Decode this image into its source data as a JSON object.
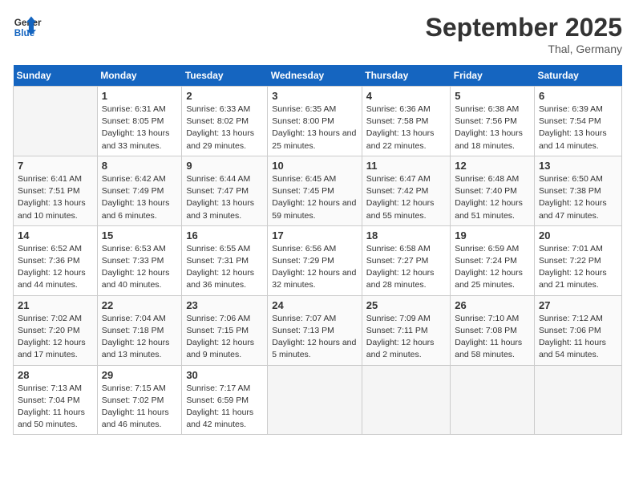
{
  "header": {
    "logo_line1": "General",
    "logo_line2": "Blue",
    "month_title": "September 2025",
    "location": "Thal, Germany"
  },
  "weekdays": [
    "Sunday",
    "Monday",
    "Tuesday",
    "Wednesday",
    "Thursday",
    "Friday",
    "Saturday"
  ],
  "weeks": [
    [
      {
        "day": "",
        "sunrise": "",
        "sunset": "",
        "daylight": ""
      },
      {
        "day": "1",
        "sunrise": "Sunrise: 6:31 AM",
        "sunset": "Sunset: 8:05 PM",
        "daylight": "Daylight: 13 hours and 33 minutes."
      },
      {
        "day": "2",
        "sunrise": "Sunrise: 6:33 AM",
        "sunset": "Sunset: 8:02 PM",
        "daylight": "Daylight: 13 hours and 29 minutes."
      },
      {
        "day": "3",
        "sunrise": "Sunrise: 6:35 AM",
        "sunset": "Sunset: 8:00 PM",
        "daylight": "Daylight: 13 hours and 25 minutes."
      },
      {
        "day": "4",
        "sunrise": "Sunrise: 6:36 AM",
        "sunset": "Sunset: 7:58 PM",
        "daylight": "Daylight: 13 hours and 22 minutes."
      },
      {
        "day": "5",
        "sunrise": "Sunrise: 6:38 AM",
        "sunset": "Sunset: 7:56 PM",
        "daylight": "Daylight: 13 hours and 18 minutes."
      },
      {
        "day": "6",
        "sunrise": "Sunrise: 6:39 AM",
        "sunset": "Sunset: 7:54 PM",
        "daylight": "Daylight: 13 hours and 14 minutes."
      }
    ],
    [
      {
        "day": "7",
        "sunrise": "Sunrise: 6:41 AM",
        "sunset": "Sunset: 7:51 PM",
        "daylight": "Daylight: 13 hours and 10 minutes."
      },
      {
        "day": "8",
        "sunrise": "Sunrise: 6:42 AM",
        "sunset": "Sunset: 7:49 PM",
        "daylight": "Daylight: 13 hours and 6 minutes."
      },
      {
        "day": "9",
        "sunrise": "Sunrise: 6:44 AM",
        "sunset": "Sunset: 7:47 PM",
        "daylight": "Daylight: 13 hours and 3 minutes."
      },
      {
        "day": "10",
        "sunrise": "Sunrise: 6:45 AM",
        "sunset": "Sunset: 7:45 PM",
        "daylight": "Daylight: 12 hours and 59 minutes."
      },
      {
        "day": "11",
        "sunrise": "Sunrise: 6:47 AM",
        "sunset": "Sunset: 7:42 PM",
        "daylight": "Daylight: 12 hours and 55 minutes."
      },
      {
        "day": "12",
        "sunrise": "Sunrise: 6:48 AM",
        "sunset": "Sunset: 7:40 PM",
        "daylight": "Daylight: 12 hours and 51 minutes."
      },
      {
        "day": "13",
        "sunrise": "Sunrise: 6:50 AM",
        "sunset": "Sunset: 7:38 PM",
        "daylight": "Daylight: 12 hours and 47 minutes."
      }
    ],
    [
      {
        "day": "14",
        "sunrise": "Sunrise: 6:52 AM",
        "sunset": "Sunset: 7:36 PM",
        "daylight": "Daylight: 12 hours and 44 minutes."
      },
      {
        "day": "15",
        "sunrise": "Sunrise: 6:53 AM",
        "sunset": "Sunset: 7:33 PM",
        "daylight": "Daylight: 12 hours and 40 minutes."
      },
      {
        "day": "16",
        "sunrise": "Sunrise: 6:55 AM",
        "sunset": "Sunset: 7:31 PM",
        "daylight": "Daylight: 12 hours and 36 minutes."
      },
      {
        "day": "17",
        "sunrise": "Sunrise: 6:56 AM",
        "sunset": "Sunset: 7:29 PM",
        "daylight": "Daylight: 12 hours and 32 minutes."
      },
      {
        "day": "18",
        "sunrise": "Sunrise: 6:58 AM",
        "sunset": "Sunset: 7:27 PM",
        "daylight": "Daylight: 12 hours and 28 minutes."
      },
      {
        "day": "19",
        "sunrise": "Sunrise: 6:59 AM",
        "sunset": "Sunset: 7:24 PM",
        "daylight": "Daylight: 12 hours and 25 minutes."
      },
      {
        "day": "20",
        "sunrise": "Sunrise: 7:01 AM",
        "sunset": "Sunset: 7:22 PM",
        "daylight": "Daylight: 12 hours and 21 minutes."
      }
    ],
    [
      {
        "day": "21",
        "sunrise": "Sunrise: 7:02 AM",
        "sunset": "Sunset: 7:20 PM",
        "daylight": "Daylight: 12 hours and 17 minutes."
      },
      {
        "day": "22",
        "sunrise": "Sunrise: 7:04 AM",
        "sunset": "Sunset: 7:18 PM",
        "daylight": "Daylight: 12 hours and 13 minutes."
      },
      {
        "day": "23",
        "sunrise": "Sunrise: 7:06 AM",
        "sunset": "Sunset: 7:15 PM",
        "daylight": "Daylight: 12 hours and 9 minutes."
      },
      {
        "day": "24",
        "sunrise": "Sunrise: 7:07 AM",
        "sunset": "Sunset: 7:13 PM",
        "daylight": "Daylight: 12 hours and 5 minutes."
      },
      {
        "day": "25",
        "sunrise": "Sunrise: 7:09 AM",
        "sunset": "Sunset: 7:11 PM",
        "daylight": "Daylight: 12 hours and 2 minutes."
      },
      {
        "day": "26",
        "sunrise": "Sunrise: 7:10 AM",
        "sunset": "Sunset: 7:08 PM",
        "daylight": "Daylight: 11 hours and 58 minutes."
      },
      {
        "day": "27",
        "sunrise": "Sunrise: 7:12 AM",
        "sunset": "Sunset: 7:06 PM",
        "daylight": "Daylight: 11 hours and 54 minutes."
      }
    ],
    [
      {
        "day": "28",
        "sunrise": "Sunrise: 7:13 AM",
        "sunset": "Sunset: 7:04 PM",
        "daylight": "Daylight: 11 hours and 50 minutes."
      },
      {
        "day": "29",
        "sunrise": "Sunrise: 7:15 AM",
        "sunset": "Sunset: 7:02 PM",
        "daylight": "Daylight: 11 hours and 46 minutes."
      },
      {
        "day": "30",
        "sunrise": "Sunrise: 7:17 AM",
        "sunset": "Sunset: 6:59 PM",
        "daylight": "Daylight: 11 hours and 42 minutes."
      },
      {
        "day": "",
        "sunrise": "",
        "sunset": "",
        "daylight": ""
      },
      {
        "day": "",
        "sunrise": "",
        "sunset": "",
        "daylight": ""
      },
      {
        "day": "",
        "sunrise": "",
        "sunset": "",
        "daylight": ""
      },
      {
        "day": "",
        "sunrise": "",
        "sunset": "",
        "daylight": ""
      }
    ]
  ]
}
